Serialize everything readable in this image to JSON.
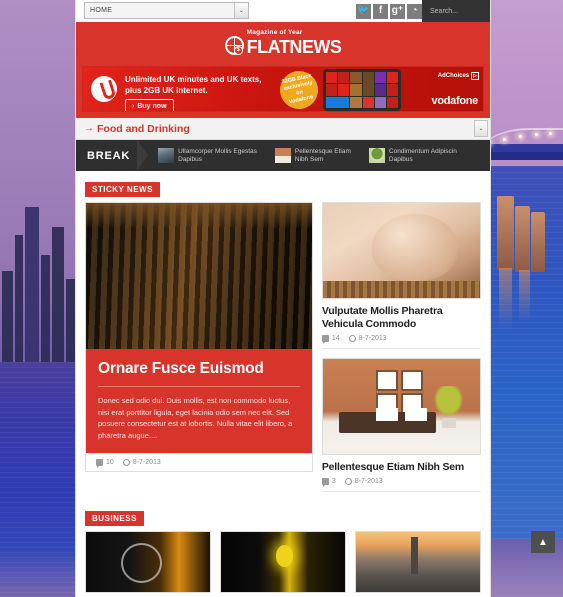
{
  "topbar": {
    "nav_value": "HOME",
    "nav_caret": "⌄",
    "social": [
      {
        "name": "twitter-icon",
        "glyph": "🐦"
      },
      {
        "name": "facebook-icon",
        "glyph": "f"
      },
      {
        "name": "googleplus-icon",
        "glyph": "g⁺"
      },
      {
        "name": "rss-icon",
        "glyph": "◔"
      }
    ],
    "search_placeholder": "Search..."
  },
  "header": {
    "logo_sub": "Magazine of Year",
    "logo_main": "FLATNEWS",
    "globe_mark": "$",
    "brand_red": "#d9342b"
  },
  "ad": {
    "headline_1": "Unlimited UK minutes and UK texts,",
    "headline_2": "plus 2GB UK internet.",
    "cta": "Buy now",
    "cta_arrow": "›",
    "burst": "32GB Black exclusively on Vodafone",
    "adchoices": "AdChoices",
    "adchoices_mark": "▷",
    "brand": "vodafone"
  },
  "category_strip": {
    "arrow": "→",
    "name": "Food and Drinking",
    "select_caret": "⌄"
  },
  "ticker": {
    "label": "BREAK",
    "items": [
      {
        "title_line1": "Ullamcorper Mollis Egestas",
        "title_line2": "Dapibus",
        "thumb": "city-thumb"
      },
      {
        "title_line1": "Pellentesque Etiam",
        "title_line2": "Nibh Sem",
        "thumb": "sofa-thumb"
      },
      {
        "title_line1": "Condimentum Adipiscin",
        "title_line2": "Dapibus",
        "thumb": "tree-thumb"
      }
    ]
  },
  "sticky": {
    "tag": "STICKY NEWS",
    "featured": {
      "image": "bookshelf-photo",
      "title": "Ornare Fusce Euismod",
      "excerpt": "Donec sed odio dui. Duis mollis, est non commodo luctus, nisi erat porttitor ligula, eget lacinia odio sem nec elit. Sed posuere consectetur est at lobortis. Nulla vitae elit libero, a pharetra augue....",
      "comments": "10",
      "date": "8-7-2013"
    },
    "cards": [
      {
        "image": "spa-massage-photo",
        "title": "Vulputate Mollis Pharetra Vehicula Commodo",
        "comments": "14",
        "date": "8-7-2013"
      },
      {
        "image": "living-room-sofa-photo",
        "title": "Pellentesque Etiam Nibh Sem",
        "comments": "3",
        "date": "8-7-2013"
      }
    ]
  },
  "business": {
    "tag": "BUSINESS",
    "thumbs": [
      {
        "image": "touchscreen-hand-photo"
      },
      {
        "image": "lightbulbs-idea-photo"
      },
      {
        "image": "city-skyline-sunset-photo"
      }
    ]
  },
  "scroll_top": {
    "label": "▲"
  },
  "icons": {
    "comment": "comment-icon",
    "clock": "clock-icon"
  }
}
